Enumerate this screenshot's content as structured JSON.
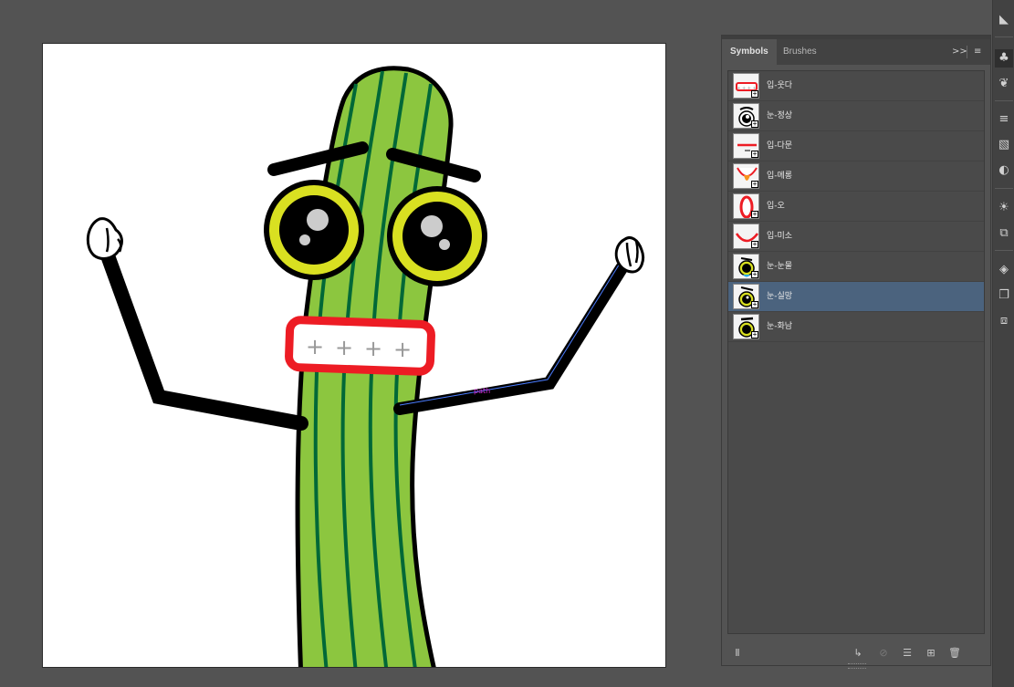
{
  "window": {
    "title": ""
  },
  "artboard": {
    "selection_label": "path",
    "mouth_marks": [
      "+",
      "+",
      "+",
      "+"
    ]
  },
  "symbols_panel": {
    "tabs": [
      {
        "label": "Symbols",
        "active": true
      },
      {
        "label": "Brushes",
        "active": false
      }
    ],
    "menu_buttons": {
      "collapse": ">>",
      "menu": "≡"
    },
    "symbols": [
      {
        "name": "입-웃다",
        "thumb": "mouth-smile-rect",
        "selected": false
      },
      {
        "name": "눈-정상",
        "thumb": "eye-normal",
        "selected": false
      },
      {
        "name": "입-다문",
        "thumb": "mouth-closed",
        "selected": false
      },
      {
        "name": "입-메롱",
        "thumb": "mouth-tongue",
        "selected": false
      },
      {
        "name": "입-오",
        "thumb": "mouth-o",
        "selected": false
      },
      {
        "name": "입-미소",
        "thumb": "mouth-smile",
        "selected": false
      },
      {
        "name": "눈-눈물",
        "thumb": "eye-tear",
        "selected": false
      },
      {
        "name": "눈-실망",
        "thumb": "eye-disappointed",
        "selected": true
      },
      {
        "name": "눈-화남",
        "thumb": "eye-angry",
        "selected": false
      }
    ],
    "bottom_icons": [
      "symbol-library-icon",
      "place-symbol-instance-icon",
      "break-link-icon",
      "symbol-options-icon",
      "new-symbol-icon",
      "delete-symbol-icon"
    ]
  },
  "colors": {
    "workspace": "#535353",
    "panel": "#535353",
    "selection_row": "#4b637e",
    "cucumber_fill": "#8cc63f",
    "cucumber_stripe": "#006837",
    "eye_ring": "#d9e021",
    "mouth_red": "#ed1c24",
    "selection_path": "#4a7cff"
  }
}
